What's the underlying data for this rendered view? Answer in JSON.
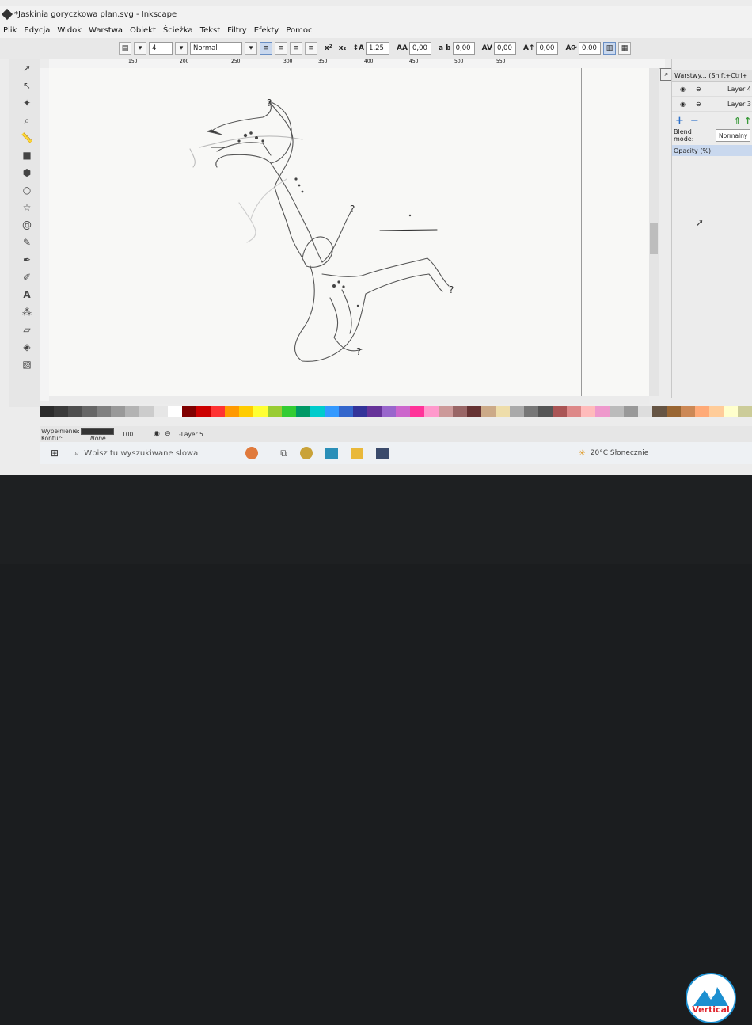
{
  "window": {
    "title": "*Jaskinia goryczkowa plan.svg - Inkscape"
  },
  "menu": [
    "Plik",
    "Edycja",
    "Widok",
    "Warstwa",
    "Obiekt",
    "Ścieżka",
    "Tekst",
    "Filtry",
    "Efekty",
    "Pomoc"
  ],
  "text_toolbar": {
    "font_size": "4",
    "font_style": "Normal",
    "line_spacing": "1,25",
    "letter_spacing": "0,00",
    "word_spacing": "0,00",
    "kerning": "0,00",
    "vertical_shift": "0,00",
    "rotation": "0,00"
  },
  "ruler_marks": [
    "150",
    "200",
    "250",
    "300",
    "350",
    "400",
    "450",
    "500",
    "550"
  ],
  "canvas": {
    "question_marks": [
      "?",
      "?",
      "?",
      "?"
    ]
  },
  "layers_panel": {
    "title": "Warstwy... (Shift+Ctrl+",
    "layers": [
      "Layer 4",
      "Layer 3"
    ],
    "blend_mode_label": "Blend mode:",
    "blend_mode_value": "Normalny",
    "opacity_label": "Opacity (%)"
  },
  "status": {
    "fill_label": "Wypełnienie:",
    "stroke_label": "Kontur:",
    "stroke_value": "None",
    "opacity_value": "100",
    "layer_value": "-Layer 5"
  },
  "taskbar": {
    "search_placeholder": "Wpisz tu wyszukiwane słowa",
    "weather": "20°C  Słonecznie"
  },
  "colors": {
    "palette": [
      "#2b2b2b",
      "#3a3a3a",
      "#4e4e4e",
      "#666",
      "#808080",
      "#999",
      "#b3b3b3",
      "#ccc",
      "#e6e6e6",
      "#fff",
      "#800000",
      "#c00",
      "#f33",
      "#f90",
      "#fc0",
      "#ff3",
      "#9c3",
      "#3c3",
      "#096",
      "#0cc",
      "#39f",
      "#36c",
      "#339",
      "#639",
      "#96c",
      "#c6c",
      "#f39",
      "#f9c",
      "#c99",
      "#966",
      "#633",
      "#ca8",
      "#eda",
      "#aaa",
      "#777",
      "#555",
      "#a55",
      "#d88",
      "#fbb",
      "#e9c",
      "#bbb",
      "#999",
      "#ddd",
      "#654",
      "#963",
      "#c85",
      "#fa7",
      "#fc9",
      "#ffc",
      "#cc9"
    ],
    "accent": "#1c8fd0"
  }
}
